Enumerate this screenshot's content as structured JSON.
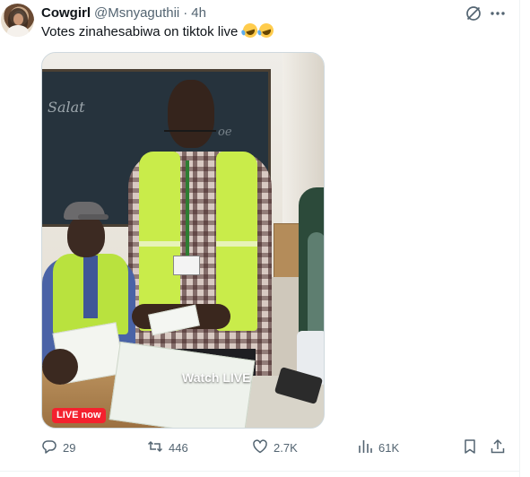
{
  "tweet": {
    "author_name": "Cowgirl",
    "handle": "@Msnyaguthii",
    "separator": "·",
    "time": "4h",
    "text": "Votes zinahesabiwa on tiktok live",
    "emoji_count": 2,
    "emoji_name": "rolling-on-the-floor-laughing"
  },
  "media": {
    "board_text": "Salat",
    "board_text_2": "oe",
    "watch_text": "Watch LIVE",
    "live_badge": "LIVE now"
  },
  "actions": {
    "replies": "29",
    "reposts": "446",
    "likes": "2.7K",
    "views": "61K"
  },
  "colors": {
    "text_primary": "#0f1419",
    "text_secondary": "#536471",
    "live_red": "#f4212e",
    "border": "#cfd9de"
  }
}
